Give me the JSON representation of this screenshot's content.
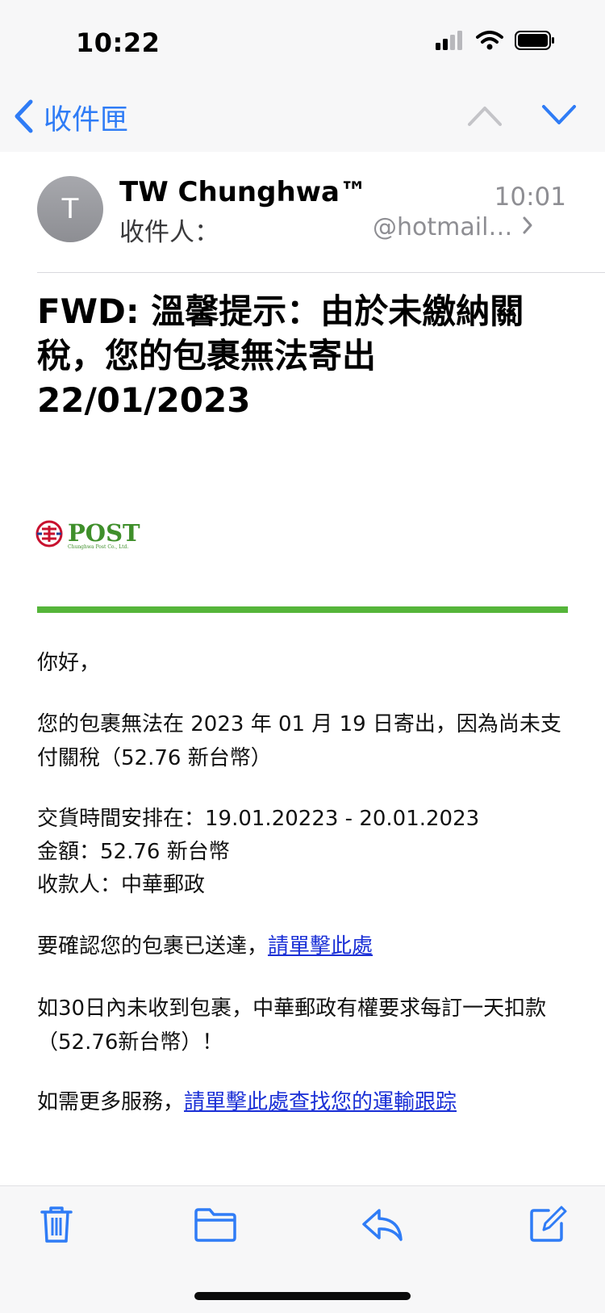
{
  "status_bar": {
    "time": "10:22"
  },
  "nav": {
    "back_label": "收件匣"
  },
  "header": {
    "avatar_initial": "T",
    "sender": "TW Chunghwa™",
    "time": "10:01",
    "to_label": "收件人：",
    "to_address": "@hotmail…"
  },
  "subject": "FWD: 溫馨提示：由於未繳納關稅，您的包裹無法寄出 22/01/2023",
  "logo": {
    "main": "POST",
    "sub": "Chunghwa Post Co., Ltd."
  },
  "body": {
    "greeting": "你好，",
    "para1": "您的包裹無法在 2023 年 01 月 19 日寄出，因為尚未支付關稅（52.76 新台幣）",
    "line_delivery": "交貨時間安排在：19.01.20223 - 20.01.2023",
    "line_amount": "金額：52.76 新台幣",
    "line_payee": "收款人：中華郵政",
    "confirm_text": "要確認您的包裹已送達，",
    "confirm_link": "請單擊此處",
    "para_penalty": "如30日內未收到包裹，中華郵政有權要求每訂一天扣款（52.76新台幣）！",
    "more_text": "如需更多服務，",
    "more_link": "請單擊此處查找您的運輸跟踪"
  },
  "colors": {
    "accent": "#2f7cf6",
    "logo_green": "#3f8f2b",
    "bar_green": "#55b53a",
    "link": "#1a2fd6"
  },
  "icons": [
    "signal-icon",
    "wifi-icon",
    "battery-icon",
    "chevron-left-icon",
    "chevron-up-icon",
    "chevron-down-icon",
    "chevron-right-icon",
    "trash-icon",
    "folder-icon",
    "reply-icon",
    "compose-icon"
  ]
}
